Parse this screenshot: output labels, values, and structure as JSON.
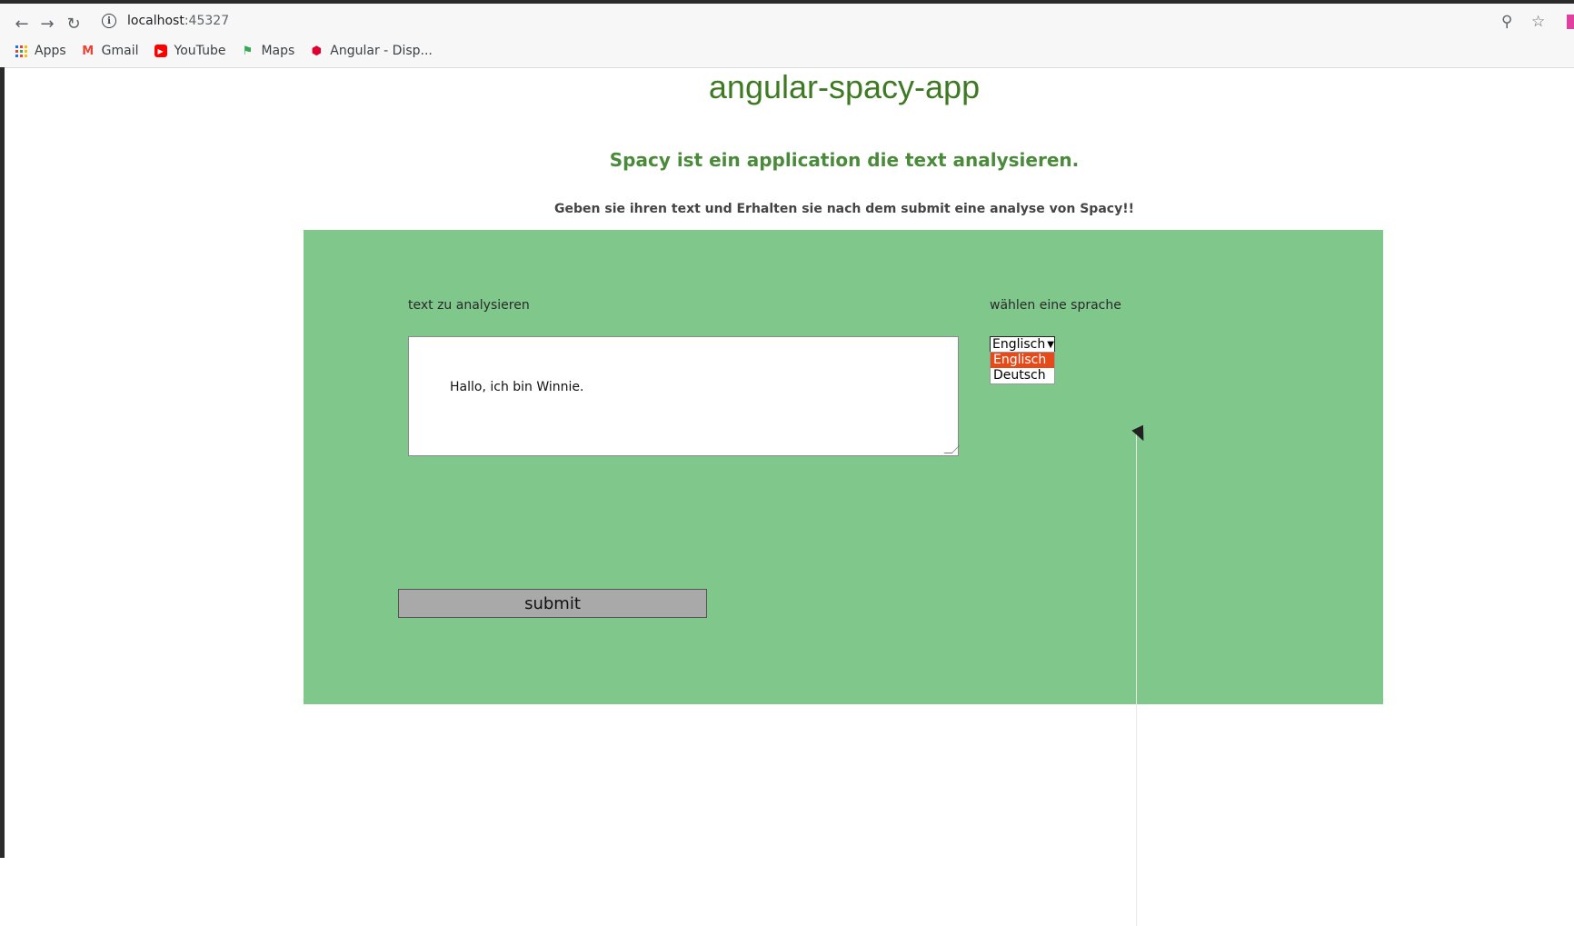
{
  "browser": {
    "url_host": "localhost",
    "url_port": ":45327",
    "bookmarks": [
      "Apps",
      "Gmail",
      "YouTube",
      "Maps",
      "Angular - Disp..."
    ]
  },
  "page": {
    "title": "angular-spacy-app",
    "subtitle": "Spacy ist ein application die text analysieren.",
    "description": "Geben sie ihren text und Erhalten sie nach dem submit eine analyse von Spacy!!"
  },
  "form": {
    "text_label": "text zu analysieren",
    "text_value": "Hallo, ich bin Winnie.",
    "language_label": "wählen eine sprache",
    "language_selected": "Englisch",
    "language_options": [
      "Englisch",
      "Deutsch"
    ],
    "submit_label": "submit"
  },
  "colors": {
    "panel": "#80c78c",
    "title": "#3e7a23",
    "option_highlight": "#e44a1a"
  }
}
